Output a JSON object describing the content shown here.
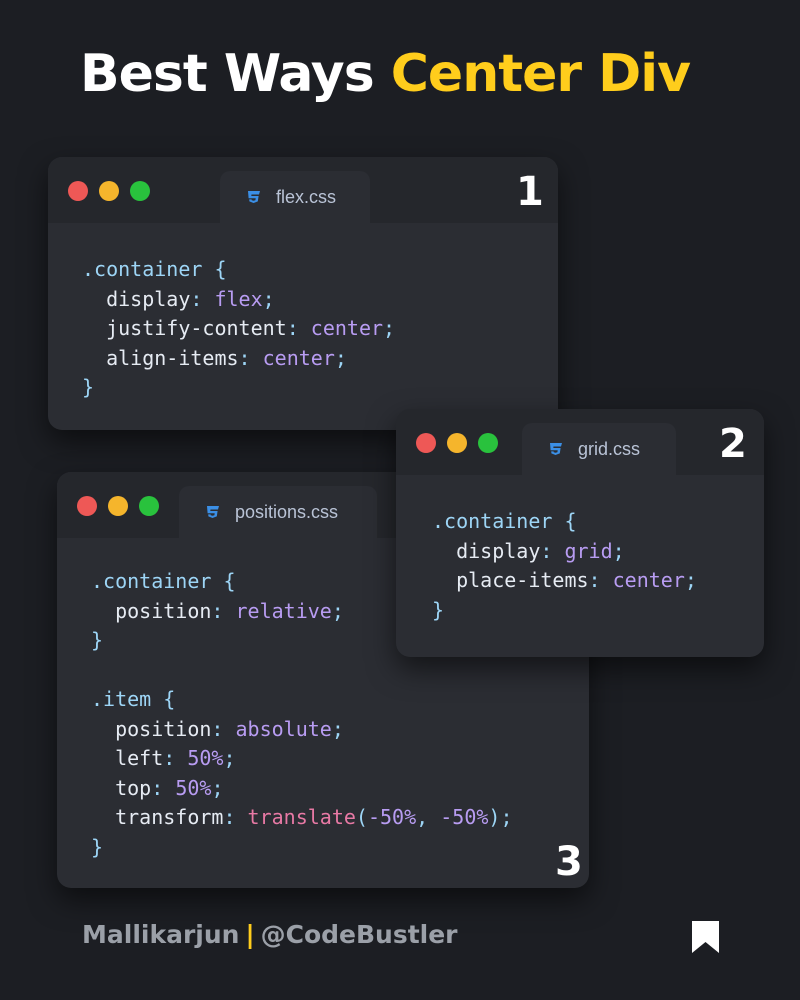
{
  "title": {
    "part1": "Best Ways",
    "part2": "Center Div"
  },
  "colors": {
    "accent": "#ffcd1c",
    "background": "#1c1e23",
    "window": "#2b2d33",
    "css_icon": "#3b8fe6"
  },
  "windows": {
    "flex": {
      "filename": "flex.css",
      "number": "1",
      "icon": "css3-icon",
      "lines": [
        [
          {
            "t": ".container",
            "c": "sel"
          },
          {
            "t": " {",
            "c": "punc"
          }
        ],
        [
          {
            "t": "  display",
            "c": "prop"
          },
          {
            "t": ": ",
            "c": "punc"
          },
          {
            "t": "flex",
            "c": "val"
          },
          {
            "t": ";",
            "c": "punc"
          }
        ],
        [
          {
            "t": "  justify-content",
            "c": "prop"
          },
          {
            "t": ": ",
            "c": "punc"
          },
          {
            "t": "center",
            "c": "val"
          },
          {
            "t": ";",
            "c": "punc"
          }
        ],
        [
          {
            "t": "  align-items",
            "c": "prop"
          },
          {
            "t": ": ",
            "c": "punc"
          },
          {
            "t": "center",
            "c": "val"
          },
          {
            "t": ";",
            "c": "punc"
          }
        ],
        [
          {
            "t": "}",
            "c": "punc"
          }
        ]
      ]
    },
    "grid": {
      "filename": "grid.css",
      "number": "2",
      "icon": "css3-icon",
      "lines": [
        [
          {
            "t": ".container",
            "c": "sel"
          },
          {
            "t": " {",
            "c": "punc"
          }
        ],
        [
          {
            "t": "  display",
            "c": "prop"
          },
          {
            "t": ": ",
            "c": "punc"
          },
          {
            "t": "grid",
            "c": "val"
          },
          {
            "t": ";",
            "c": "punc"
          }
        ],
        [
          {
            "t": "  place-items",
            "c": "prop"
          },
          {
            "t": ": ",
            "c": "punc"
          },
          {
            "t": "center",
            "c": "val"
          },
          {
            "t": ";",
            "c": "punc"
          }
        ],
        [
          {
            "t": "}",
            "c": "punc"
          }
        ]
      ]
    },
    "positions": {
      "filename": "positions.css",
      "number": "3",
      "icon": "css3-icon",
      "lines": [
        [
          {
            "t": ".container",
            "c": "sel"
          },
          {
            "t": " {",
            "c": "punc"
          }
        ],
        [
          {
            "t": "  position",
            "c": "prop"
          },
          {
            "t": ": ",
            "c": "punc"
          },
          {
            "t": "relative",
            "c": "val"
          },
          {
            "t": ";",
            "c": "punc"
          }
        ],
        [
          {
            "t": "}",
            "c": "punc"
          }
        ],
        [
          {
            "t": "",
            "c": "punc"
          }
        ],
        [
          {
            "t": ".item",
            "c": "sel"
          },
          {
            "t": " {",
            "c": "punc"
          }
        ],
        [
          {
            "t": "  position",
            "c": "prop"
          },
          {
            "t": ": ",
            "c": "punc"
          },
          {
            "t": "absolute",
            "c": "val"
          },
          {
            "t": ";",
            "c": "punc"
          }
        ],
        [
          {
            "t": "  left",
            "c": "prop"
          },
          {
            "t": ": ",
            "c": "punc"
          },
          {
            "t": "50%",
            "c": "val"
          },
          {
            "t": ";",
            "c": "punc"
          }
        ],
        [
          {
            "t": "  top",
            "c": "prop"
          },
          {
            "t": ": ",
            "c": "punc"
          },
          {
            "t": "50%",
            "c": "val"
          },
          {
            "t": ";",
            "c": "punc"
          }
        ],
        [
          {
            "t": "  transform",
            "c": "prop"
          },
          {
            "t": ": ",
            "c": "punc"
          },
          {
            "t": "translate",
            "c": "fn"
          },
          {
            "t": "(",
            "c": "punc"
          },
          {
            "t": "-50%",
            "c": "val"
          },
          {
            "t": ", ",
            "c": "punc"
          },
          {
            "t": "-50%",
            "c": "val"
          },
          {
            "t": ");",
            "c": "punc"
          }
        ],
        [
          {
            "t": "}",
            "c": "punc"
          }
        ]
      ]
    }
  },
  "footer": {
    "author": "Mallikarjun",
    "separator": "|",
    "handle": "@CodeBustler",
    "icon": "bookmark-icon"
  }
}
